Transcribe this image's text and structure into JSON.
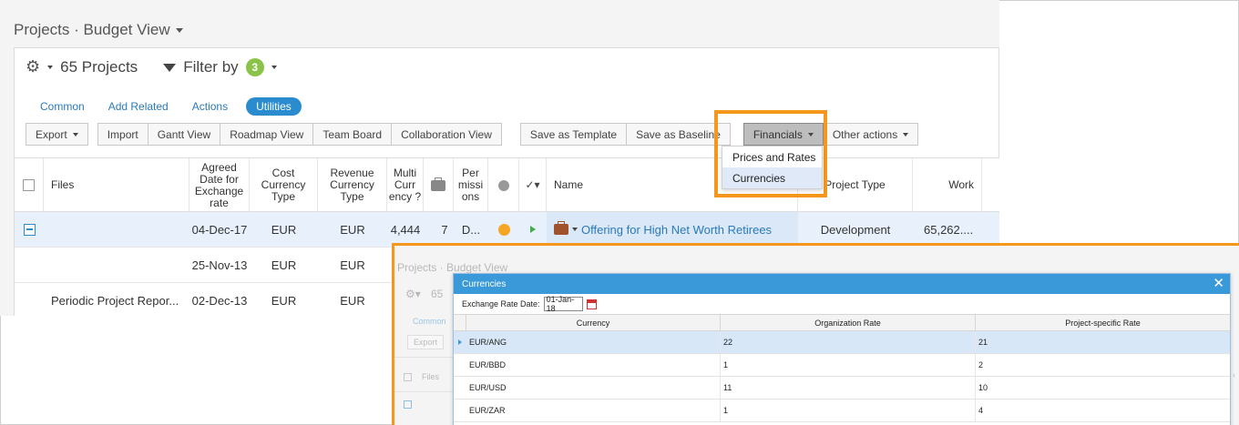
{
  "breadcrumb": "Projects · Budget View",
  "toolbar": {
    "project_count": "65 Projects",
    "filter_label": "Filter by",
    "filter_count": "3"
  },
  "tabs": [
    "Common",
    "Add Related",
    "Actions",
    "Utilities"
  ],
  "buttons": {
    "export": "Export",
    "import": "Import",
    "gantt": "Gantt View",
    "roadmap": "Roadmap View",
    "team_board": "Team Board",
    "collaboration": "Collaboration View",
    "save_template": "Save as Template",
    "save_baseline": "Save as Baseline",
    "financials": "Financials",
    "other_actions": "Other actions"
  },
  "financials_menu": [
    "Prices and Rates",
    "Currencies"
  ],
  "grid": {
    "headers": {
      "files": "Files",
      "agreed_date": "Agreed Date for Exchange rate",
      "cost_currency": "Cost Currency Type",
      "revenue_currency": "Revenue Currency Type",
      "multi_currency": "Multi Curr ency ?",
      "permissions": "Per missi ons",
      "name": "Name",
      "project_type": "Project Type",
      "work": "Work"
    },
    "rows": [
      {
        "files": "",
        "date": "04-Dec-17",
        "cost": "EUR",
        "revenue": "EUR",
        "multi": "4,444",
        "count": "7",
        "perm": "D...",
        "name": "Offering for High Net Worth Retirees",
        "type": "Development",
        "work": "65,262...."
      },
      {
        "files": "",
        "date": "25-Nov-13",
        "cost": "EUR",
        "revenue": "EUR"
      },
      {
        "files": "Periodic Project Repor...",
        "date": "02-Dec-13",
        "cost": "EUR",
        "revenue": "EUR"
      }
    ]
  },
  "zoom_ghost": {
    "breadcrumb": "Projects · Budget View",
    "count_fragment": "65",
    "tab": "Common",
    "export": "Export",
    "files": "Files"
  },
  "dialog": {
    "title": "Currencies",
    "rate_label": "Exchange Rate Date:",
    "rate_value": "01-Jan-18",
    "columns": [
      "Currency",
      "Organization Rate",
      "Project-specific Rate"
    ],
    "rows": [
      {
        "currency": "EUR/ANG",
        "org": "22",
        "proj": "21"
      },
      {
        "currency": "EUR/BBD",
        "org": "1",
        "proj": "2"
      },
      {
        "currency": "EUR/USD",
        "org": "11",
        "proj": "10"
      },
      {
        "currency": "EUR/ZAR",
        "org": "1",
        "proj": "4"
      }
    ]
  }
}
